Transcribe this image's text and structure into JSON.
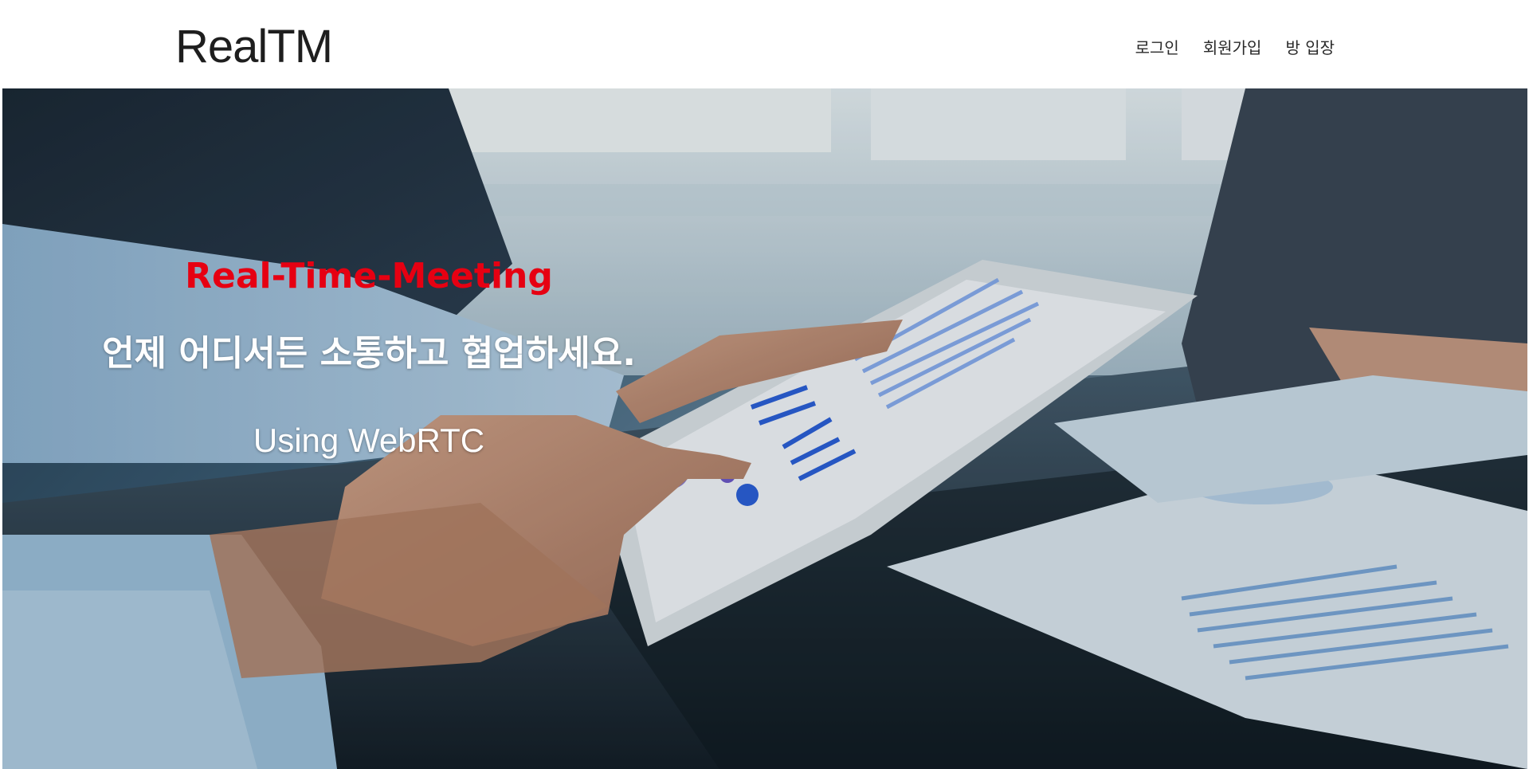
{
  "header": {
    "brand": "RealTM",
    "nav": {
      "login": "로그인",
      "signup": "회원가입",
      "join_room": "방 입장"
    }
  },
  "hero": {
    "title": "Real-Time-Meeting",
    "subtitle": "언제 어디서든 소통하고 협업하세요.",
    "tech": "Using WebRTC",
    "image_description_icon": "business-meeting-photo"
  },
  "colors": {
    "title_accent": "#e60012",
    "hero_text": "#ffffff",
    "brand_text": "#1e1e1e"
  }
}
